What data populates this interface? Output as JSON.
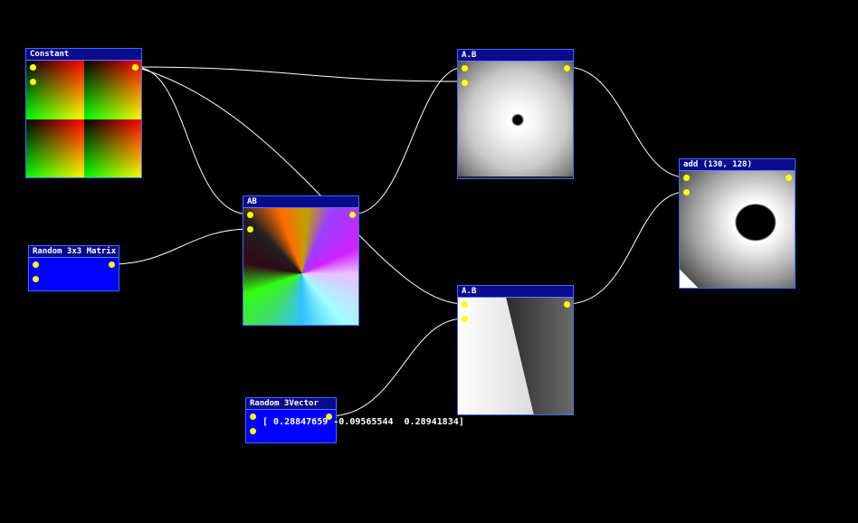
{
  "nodes": {
    "constant": {
      "title": "Constant"
    },
    "ab_top": {
      "title": "A.B"
    },
    "add": {
      "title": "add (130, 128)"
    },
    "ab_mid": {
      "title": "AB"
    },
    "random_matrix": {
      "title": "Random 3x3 Matrix"
    },
    "ab_bottom": {
      "title": "A.B"
    },
    "random_vector": {
      "title": "Random 3Vector",
      "value": "[ 0.28847659 -0.09565544  0.28941834]"
    }
  },
  "colors": {
    "port": "#ffff00",
    "wire": "#ffffff",
    "node_border": "#3a6cff",
    "title_bg": "#0a0a8c",
    "param_bg": "#0000ff"
  }
}
